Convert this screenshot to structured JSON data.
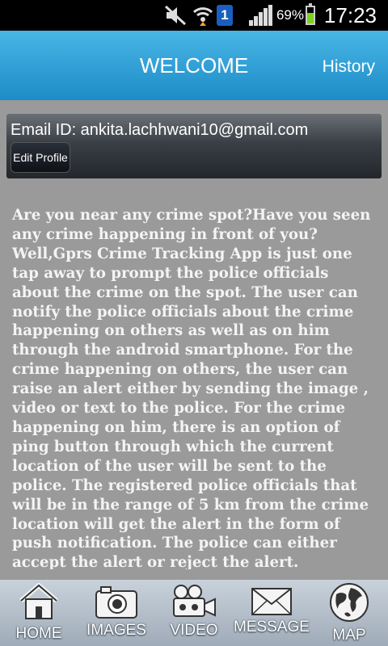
{
  "status_bar": {
    "time": "17:23",
    "battery_text": "69%",
    "sim_label": "1",
    "icons": [
      "mute-icon",
      "wifi-icon",
      "sim-icon",
      "signal-icon",
      "battery-icon"
    ]
  },
  "header": {
    "title": "WELCOME",
    "history_label": "History"
  },
  "profile": {
    "email_text": "Email ID: ankita.lachhwani10@gmail.com",
    "edit_label": "Edit Profile"
  },
  "about": {
    "text": "Are you near any crime spot?Have you seen any crime happening in front of you?Well,Gprs Crime Tracking App is just one tap away to prompt the police officials about the crime on the spot. The user can notify the police officials about the crime happening on others as well as on him through the android smartphone. For the crime happening on others, the user can raise an alert either by sending the image , video or text to the police. For the crime happening on him, there is an option of ping button through which the current location of the user will be sent to the police. The registered police officials that will be in the range of 5 km from the crime location will get the alert in the form of push notification. The police can either accept the alert or reject the alert."
  },
  "tabs": {
    "home": {
      "label": "HOME",
      "icon": "home-icon"
    },
    "images": {
      "label": "IMAGES",
      "icon": "camera-icon"
    },
    "video": {
      "label": "VIDEO",
      "icon": "video-camera-icon"
    },
    "message": {
      "label": "MESSAGE",
      "icon": "envelope-icon"
    },
    "map": {
      "label": "MAP",
      "icon": "globe-icon"
    }
  },
  "colors": {
    "header_blue": "#1d8cc7",
    "background_gray": "#9a9a9a",
    "profile_dark": "#23272c",
    "tabbar": "#b5c0cb"
  }
}
